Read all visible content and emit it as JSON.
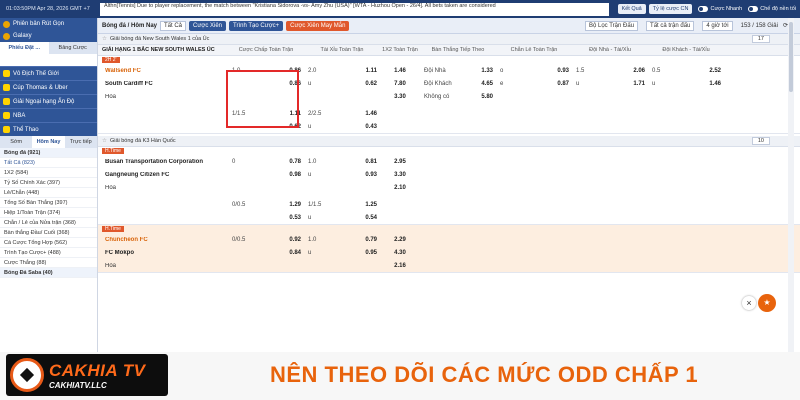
{
  "topbar": {
    "time": "01:03:50PM Apr 28, 2026 GMT +7",
    "ticker": "Althn[Tennis] Due to player replacement, the match between \"Kristiana Sidorova -vs- Amy Zhu (USA)\" [WTA - Huzhou Open - 26/4]. All bets taken are considered",
    "ticker2": "at this lee is the...",
    "btn_result": "Kết Quả",
    "btn_odds": "Tỷ lệ cược CN",
    "toggle_fast": "Cược Nhanh",
    "toggle_single": "Chế độ nền tối"
  },
  "sidebar": {
    "top_items": [
      {
        "label": "Phiên bản Rút Gọn"
      },
      {
        "label": "Galaxy"
      }
    ],
    "tabs": [
      "Phiếu Đặt ...",
      "Bảng Cược"
    ],
    "categories": [
      {
        "label": "Vô Địch Thế Giới"
      },
      {
        "label": "Cúp Thomas & Uber"
      },
      {
        "label": "Giải Ngoại hạng Ấn Độ"
      },
      {
        "label": "NBA"
      },
      {
        "label": "Thể Thao"
      }
    ],
    "time_tabs": [
      "Sớm",
      "Hôm Nay",
      "Trực tiếp"
    ],
    "sport_head": "Bóng đá (921)",
    "items": [
      {
        "label": "Tất Cả (823)"
      },
      {
        "label": "1X2 (584)"
      },
      {
        "label": "Tỷ Số Chính Xác (397)"
      },
      {
        "label": "Lẻ/Chẵn (448)"
      },
      {
        "label": "Tổng Số Bàn Thắng (397)"
      },
      {
        "label": "Hiệp 1/Toàn Trận (374)"
      },
      {
        "label": "Chẵn / Lẻ của Nửa trận (368)"
      },
      {
        "label": "Bàn thắng Đầu/ Cuối (368)"
      },
      {
        "label": "Cá Cược Tổng Hợp (562)"
      },
      {
        "label": "Trình Tạo Cược+ (488)"
      },
      {
        "label": "Cược Thắng (88)"
      }
    ],
    "bottom_item": "Bóng Đá Saba (40)"
  },
  "filterbar": {
    "sport": "Bóng đá / Hôm Nay",
    "all": "Tất Cả",
    "btn_parlay": "Cược Xiên",
    "btn_builder": "Trình Tạo Cược+",
    "btn_lucky": "Cược Xiên May Mắn",
    "filter_league": "Bộ Lọc Trận Đấu",
    "filter_all": "Tất cả trận đấu",
    "time_sort": "4 giờ tới",
    "count": "153 / 158 Giải"
  },
  "headers": {
    "hdp_ft": "Cược Chấp Toàn Trận",
    "ou_ft": "Tài Xỉu Toàn Trận",
    "x12_ft": "1X2 Toàn Trận",
    "next_goal": "Bàn Thắng Tiếp Theo",
    "oe_ft": "Chẵn Lẻ Toàn Trận",
    "home_ou": "Đội Nhà - Tài/Xỉu",
    "away_ou": "Đội Khách - Tài/Xỉu"
  },
  "leagues": [
    {
      "name": "Giải bóng đá New South Wales 1 của Úc",
      "count": "17",
      "subname": "GIẢI HẠNG 1 BẮC NEW SOUTH WALES ÚC",
      "live": "2H 2'",
      "matches": [
        {
          "home": "Wallsend FC",
          "away": "South Cardiff FC",
          "draw": "Hòa",
          "score_home": "0",
          "score_away": "0",
          "hdp": "1.0",
          "hdp_h": "0.86",
          "hdp_a": "0.86",
          "ou": "2.0",
          "ou_u": "u",
          "ou_o": "1.11",
          "ou_u_odds": "0.62",
          "x1": "1.46",
          "x2": "7.80",
          "xd": "3.30",
          "ng_h": "Đội Nhà",
          "ng_h_o": "1.33",
          "ng_a": "Đội Khách",
          "ng_a_o": "4.65",
          "ng_n": "Không có",
          "ng_n_o": "5.80",
          "oe_o": "o",
          "oe_o_v": "0.93",
          "oe_e": "e",
          "oe_e_v": "0.87",
          "ho_line": "1.5",
          "ho_o": "2.06",
          "ho_u": "u",
          "ho_u_v": "1.71",
          "ao_line": "0.5",
          "ao_o": "2.52",
          "ao_u": "u",
          "ao_u_v": "1.46",
          "alt_hdp": "1/1.5",
          "alt_hdp_h": "1.11",
          "alt_hdp_a": "0.62",
          "alt_ou": "2/2.5",
          "alt_ou_o": "1.46",
          "alt_ou_u": "u",
          "alt_ou_u_v": "0.43"
        }
      ]
    },
    {
      "name": "Giải bóng đá K3 Hàn Quốc",
      "count": "10",
      "live": "H.Time",
      "matches": [
        {
          "home": "Busan Transportation Corporation",
          "away": "Gangneung Citizen FC",
          "draw": "Hòa",
          "score_home": "0",
          "score_away": "0",
          "hdp": "0",
          "hdp_h": "0.78",
          "hdp_a": "0.98",
          "ou": "1.0",
          "ou_u": "u",
          "ou_o": "0.81",
          "ou_u_odds": "0.93",
          "x1": "2.95",
          "x2": "3.30",
          "xd": "2.10",
          "alt_hdp": "0/0.5",
          "alt_hdp_h": "1.29",
          "alt_hdp_a": "0.53",
          "alt_ou": "1/1.5",
          "alt_ou_o": "1.25",
          "alt_ou_u": "u",
          "alt_ou_u_v": "0.54"
        },
        {
          "home": "Chuncheon FC",
          "away": "FC Mokpo",
          "draw": "Hòa",
          "score_home": "0",
          "score_away": "0",
          "live": "H.Time",
          "hdp": "0/0.5",
          "hdp_h": "0.92",
          "hdp_a": "0.84",
          "ou": "1.0",
          "ou_u": "u",
          "ou_o": "0.79",
          "ou_u_odds": "0.95",
          "x1": "2.29",
          "x2": "4.30",
          "xd": "2.16"
        }
      ]
    }
  ],
  "logo": {
    "brand": "CAKHIA TV",
    "url": "CAKHIATV.LLC"
  },
  "banner": {
    "title": "NÊN THEO DÕI CÁC MỨC ODD CHẤP 1"
  },
  "colors": {
    "primary": "#2f5597",
    "accent": "#e8630c",
    "highlight_box": "#e32929"
  }
}
